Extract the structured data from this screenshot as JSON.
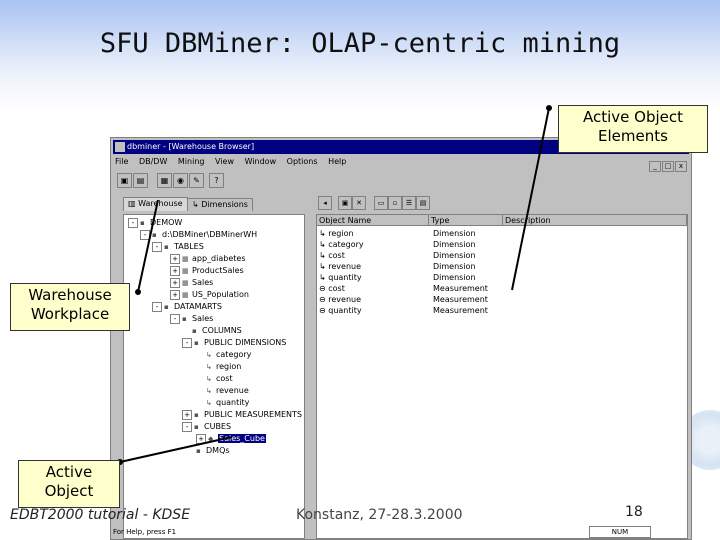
{
  "slide": {
    "title": "SFU DBMiner: OLAP-centric mining",
    "callouts": {
      "active_object_elements": "Active Object Elements",
      "warehouse_workplace": "Warehouse Workplace",
      "active_object": "Active Object"
    },
    "footer": {
      "left": "EDBT2000 tutorial - KDSE",
      "middle": "Konstanz, 27-28.3.2000",
      "page_number": "18"
    }
  },
  "window": {
    "title": "dbminer - [Warehouse Browser]",
    "menu": [
      "File",
      "DB/DW",
      "Mining",
      "View",
      "Window",
      "Options",
      "Help"
    ],
    "mdi_buttons": [
      "_",
      "□",
      "x"
    ],
    "toolbar_icons": [
      "save-icon",
      "print-icon",
      "table-icon",
      "view-icon",
      "tools-icon",
      "help-icon"
    ],
    "tabs": [
      {
        "label": "Warehouse",
        "active": true
      },
      {
        "label": "Dimensions",
        "active": false
      }
    ],
    "tree": [
      {
        "label": "DEMOW",
        "expand": "-"
      },
      {
        "label": "d:\\DBMiner\\DBMinerWH",
        "expand": "-"
      },
      {
        "label": "TABLES",
        "expand": "-"
      },
      {
        "label": "app_diabetes",
        "expand": "+"
      },
      {
        "label": "ProductSales",
        "expand": "+"
      },
      {
        "label": "Sales",
        "expand": "+"
      },
      {
        "label": "US_Population",
        "expand": "+"
      },
      {
        "label": "DATAMARTS",
        "expand": "-"
      },
      {
        "label": "Sales",
        "expand": "-"
      },
      {
        "label": "COLUMNS",
        "expand": ""
      },
      {
        "label": "PUBLIC DIMENSIONS",
        "expand": "-"
      },
      {
        "label": "category",
        "expand": ""
      },
      {
        "label": "region",
        "expand": ""
      },
      {
        "label": "cost",
        "expand": ""
      },
      {
        "label": "revenue",
        "expand": ""
      },
      {
        "label": "quantity",
        "expand": ""
      },
      {
        "label": "PUBLIC MEASUREMENTS",
        "expand": "+"
      },
      {
        "label": "CUBES",
        "expand": "-"
      },
      {
        "label": "Sales_Cube",
        "expand": "+",
        "selected": true
      },
      {
        "label": "DMQs",
        "expand": ""
      }
    ],
    "list": {
      "headers": [
        "Object Name",
        "Type",
        "Description"
      ],
      "rows": [
        {
          "name": "region",
          "type": "Dimension"
        },
        {
          "name": "category",
          "type": "Dimension"
        },
        {
          "name": "cost",
          "type": "Dimension"
        },
        {
          "name": "revenue",
          "type": "Dimension"
        },
        {
          "name": "quantity",
          "type": "Dimension"
        },
        {
          "name": "cost",
          "type": "Measurement"
        },
        {
          "name": "revenue",
          "type": "Measurement"
        },
        {
          "name": "quantity",
          "type": "Measurement"
        }
      ]
    },
    "status": {
      "left": "For Help, press F1",
      "right": "NUM"
    }
  }
}
